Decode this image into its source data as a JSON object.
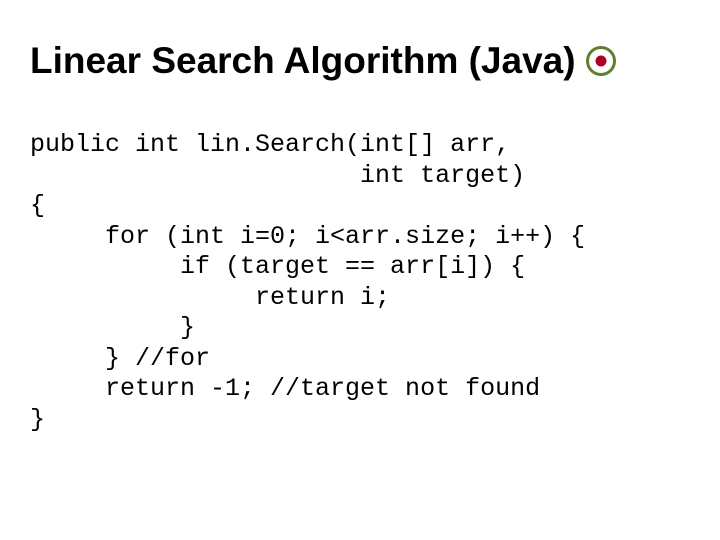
{
  "slide": {
    "title": "Linear Search Algorithm (Java)",
    "code": {
      "l1": "public int lin.Search(int[] arr,",
      "l2": "                      int target)",
      "l3": "{",
      "l4": "     for (int i=0; i<arr.size; i++) {",
      "l5": "          if (target == arr[i]) {",
      "l6": "               return i;",
      "l7": "          }",
      "l8": "     } //for",
      "l9": "     return -1; //target not found",
      "l10": "}"
    }
  }
}
